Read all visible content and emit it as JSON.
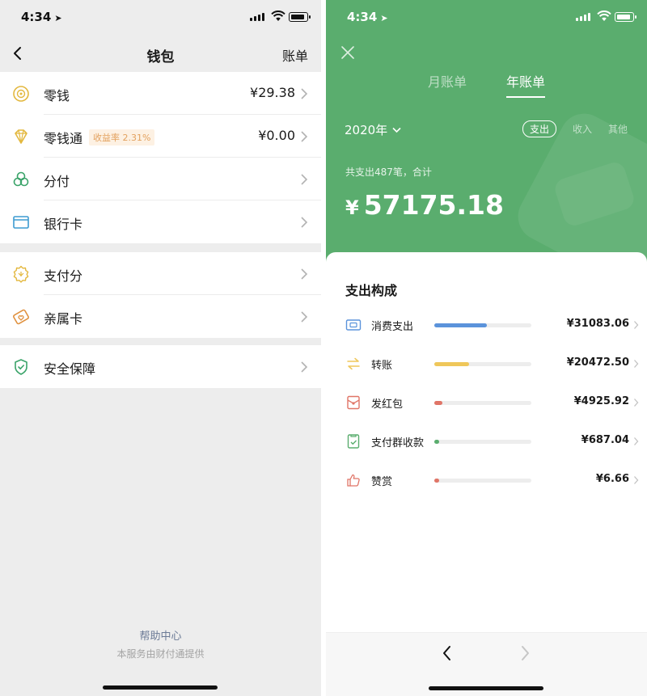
{
  "status_bar": {
    "time": "4:34"
  },
  "wallet": {
    "nav": {
      "title": "钱包",
      "bill_label": "账单"
    },
    "groups": [
      [
        {
          "label": "零钱",
          "value": "¥29.38",
          "icon": "coin-icon",
          "color": "#e3b83f"
        },
        {
          "label": "零钱通",
          "badge": "收益率 2.31%",
          "value": "¥0.00",
          "icon": "diamond-icon",
          "color": "#e3b83f"
        },
        {
          "label": "分付",
          "value": "",
          "icon": "clover-icon",
          "color": "#3ba46a"
        },
        {
          "label": "银行卡",
          "value": "",
          "icon": "card-icon",
          "color": "#3d9bd1"
        }
      ],
      [
        {
          "label": "支付分",
          "value": "",
          "icon": "badge-icon",
          "color": "#e3b83f"
        },
        {
          "label": "亲属卡",
          "value": "",
          "icon": "family-card-icon",
          "color": "#e0913f"
        }
      ],
      [
        {
          "label": "安全保障",
          "value": "",
          "icon": "shield-icon",
          "color": "#3ba46a"
        }
      ]
    ],
    "footer": {
      "help": "帮助中心",
      "provider": "本服务由财付通提供"
    }
  },
  "bill": {
    "header_color": "#5aad6e",
    "tabs": {
      "month": "月账单",
      "year": "年账单"
    },
    "year_selector": "2020年",
    "filters": [
      {
        "label": "支出",
        "active": true
      },
      {
        "label": "收入",
        "active": false
      },
      {
        "label": "其他",
        "active": false
      }
    ],
    "summary": "共支出487笔，合计",
    "currency": "¥",
    "total": "57175.18",
    "section_title": "支出构成",
    "categories": [
      {
        "label": "消费支出",
        "value": "¥31083.06",
        "share": 0.544,
        "color": "#5b93db",
        "icon": "wallet-icon"
      },
      {
        "label": "转账",
        "value": "¥20472.50",
        "share": 0.358,
        "color": "#efc75a",
        "icon": "transfer-icon"
      },
      {
        "label": "发红包",
        "value": "¥4925.92",
        "share": 0.086,
        "color": "#e07567",
        "icon": "red-packet-icon"
      },
      {
        "label": "支付群收款",
        "value": "¥687.04",
        "share": 0.012,
        "color": "#5aad6e",
        "icon": "group-collect-icon"
      },
      {
        "label": "赞赏",
        "value": "¥6.66",
        "share": 0.0001,
        "color": "#e07567",
        "icon": "thumbs-up-icon"
      }
    ]
  }
}
